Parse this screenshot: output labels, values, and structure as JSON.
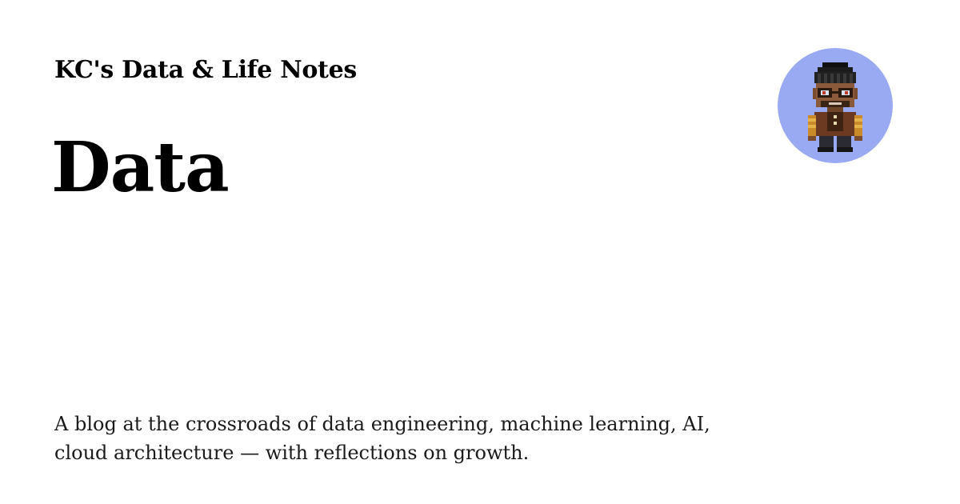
{
  "site": {
    "name": "KC's Data & Life Notes"
  },
  "page": {
    "title": "Data",
    "description": "A blog at the crossroads of data engineering, machine learning, AI, cloud architecture — with reflections on growth."
  },
  "avatar": {
    "icon": "pixel-character-avatar-icon",
    "background_color": "#9aaaf2"
  }
}
